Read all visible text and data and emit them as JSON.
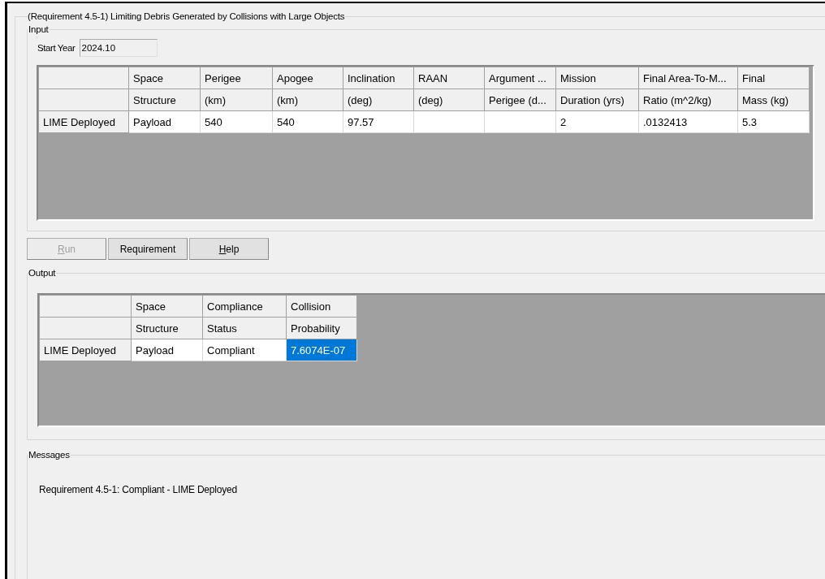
{
  "group_title": "(Requirement 4.5-1) Limiting Debris Generated by Collisions with Large Objects",
  "input": {
    "title": "Input",
    "start_year": {
      "label": "Start Year",
      "value": "2024.10"
    },
    "table": {
      "columns": [
        {
          "lines": [
            "Space",
            "Structure"
          ]
        },
        {
          "lines": [
            "Perigee",
            "(km)"
          ]
        },
        {
          "lines": [
            "Apogee",
            "(km)"
          ]
        },
        {
          "lines": [
            "Inclination",
            "(deg)"
          ]
        },
        {
          "lines": [
            "RAAN",
            "(deg)"
          ]
        },
        {
          "lines": [
            "Argument ...",
            "Perigee (d..."
          ]
        },
        {
          "lines": [
            "Mission",
            "Duration (yrs)"
          ]
        },
        {
          "lines": [
            "Final Area-To-M...",
            "Ratio (m^2/kg)"
          ]
        },
        {
          "lines": [
            "Final",
            "Mass (kg)"
          ]
        }
      ],
      "rows": [
        {
          "header": "LIME Deployed",
          "cells": [
            {
              "text": "Payload",
              "selected": false
            },
            {
              "text": "540",
              "selected": false
            },
            {
              "text": "540",
              "selected": false
            },
            {
              "text": "97.57",
              "selected": false
            },
            {
              "selected": false
            },
            {
              "selected": false
            },
            {
              "text": "2",
              "selected": false
            },
            {
              "text": ".0132413",
              "selected": false
            },
            {
              "text": "5.3",
              "selected": false
            }
          ]
        }
      ]
    }
  },
  "buttons": [
    {
      "label": "Run",
      "disabled": true,
      "underline_first": true
    },
    {
      "label": "Requirement",
      "disabled": false,
      "underline_first": false
    },
    {
      "label": "Help",
      "disabled": false,
      "underline_first": true
    }
  ],
  "output": {
    "title": "Output",
    "table": {
      "columns": [
        {
          "lines": [
            "Space",
            "Structure"
          ]
        },
        {
          "lines": [
            "Compliance",
            "Status"
          ]
        },
        {
          "lines": [
            "Collision",
            "Probability"
          ]
        }
      ],
      "rows": [
        {
          "header": "LIME Deployed",
          "cells": [
            {
              "text": "Payload",
              "selected": false
            },
            {
              "text": "Compliant",
              "selected": false
            },
            {
              "text": "7.6074E-07",
              "selected": true
            }
          ]
        }
      ]
    }
  },
  "messages": {
    "title": "Messages",
    "lines": [
      "Requirement 4.5-1: Compliant - LIME Deployed"
    ]
  }
}
